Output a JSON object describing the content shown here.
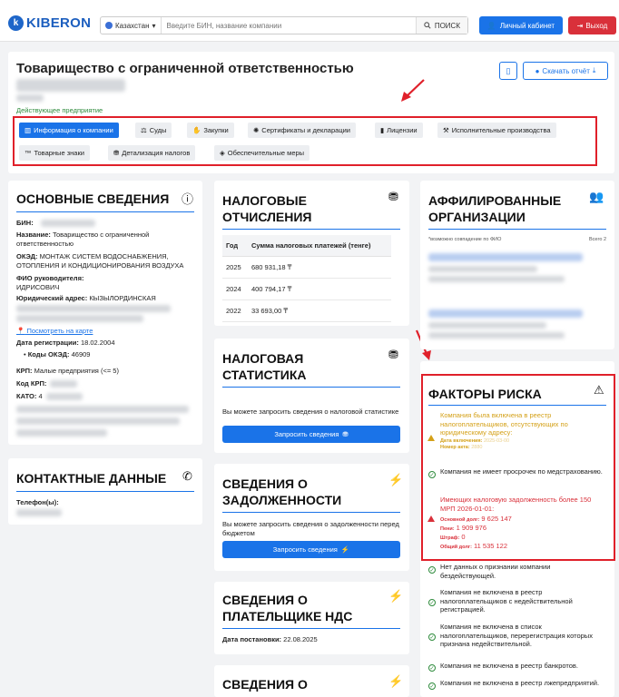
{
  "header": {
    "logo_text": "KIBERON",
    "country": "Казахстан",
    "search_placeholder": "Введите БИН, название компании",
    "search_button": "ПОИСК",
    "cabinet_button": "Личный кабинет",
    "exit_button": "Выход"
  },
  "company": {
    "title": "Товарищество с ограниченной ответственностью",
    "status": "Действующее предприятие",
    "download_button": "Скачать отчёт"
  },
  "tabs": [
    {
      "label": "Информация о компании",
      "active": true
    },
    {
      "label": "Суды"
    },
    {
      "label": "Закупки"
    },
    {
      "label": "Сертификаты и декларации"
    },
    {
      "label": "Лицензии"
    },
    {
      "label": "Исполнительные производства"
    },
    {
      "label": "Товарные знаки"
    },
    {
      "label": "Детализация налогов"
    },
    {
      "label": "Обеспечительные меры"
    }
  ],
  "basic": {
    "title": "ОСНОВНЫЕ СВЕДЕНИЯ",
    "bin_label": "БИН:",
    "name_label": "Название:",
    "name_value": "Товарищество с ограниченной ответственностью",
    "oked_label": "ОКЭД:",
    "oked_value": "МОНТАЖ СИСТЕМ ВОДОСНАБЖЕНИЯ, ОТОПЛЕНИЯ И КОНДИЦИОНИРОВАНИЯ ВОЗДУХА",
    "director_label": "ФИО руководителя:",
    "director_value": "ИДРИСОВИЧ",
    "address_label": "Юридический адрес:",
    "address_value": "КЫЗЫЛОРДИНСКАЯ",
    "map_link": "Посмотреть на карте",
    "reg_label": "Дата регистрации:",
    "reg_value": "18.02.2004",
    "oked_codes_label": "Коды ОКЭД:",
    "oked_codes_value": "46909",
    "krp_label": "КРП:",
    "krp_value": "Малые предприятия (<= 5)",
    "krp_code_label": "Код КРП:",
    "kato_label": "КАТО:",
    "kato_value": "4"
  },
  "contacts": {
    "title": "КОНТАКТНЫЕ ДАННЫЕ",
    "phones_label": "Телефон(ы):"
  },
  "tax": {
    "title_line1": "НАЛОГОВЫЕ",
    "title_line2": "ОТЧИСЛЕНИЯ",
    "col_year": "Год",
    "col_sum": "Сумма налоговых платежей (тенге)",
    "rows": [
      {
        "year": "2025",
        "sum": "680 931,18 ₸"
      },
      {
        "year": "2024",
        "sum": "400 794,17 ₸"
      },
      {
        "year": "2022",
        "sum": "33 693,00 ₸"
      }
    ]
  },
  "tax_stat": {
    "title_line1": "НАЛОГОВАЯ",
    "title_line2": "СТАТИСТИКА",
    "desc": "Вы можете запросить сведения о налоговой статистике",
    "button": "Запросить сведения"
  },
  "debt": {
    "title_line1": "СВЕДЕНИЯ О",
    "title_line2": "ЗАДОЛЖЕННОСТИ",
    "desc": "Вы можете запросить сведения о задолженности перед бюджетом",
    "button": "Запросить сведения"
  },
  "vat": {
    "title_line1": "СВЕДЕНИЯ О",
    "title_line2": "ПЛАТЕЛЬЩИКЕ НДС",
    "date_label": "Дата постановки:",
    "date_value": "22.08.2025"
  },
  "last": {
    "title_line1": "СВЕДЕНИЯ О"
  },
  "affiliates": {
    "title_line1": "АФФИЛИРОВАННЫЕ",
    "title_line2": "ОРГАНИЗАЦИИ",
    "note": "*возможно совпадение по ФИО",
    "total": "Всего 2"
  },
  "risk": {
    "title": "ФАКТОРЫ РИСКА",
    "item1": "Компания была включена в реестр налогоплательщиков, отсутствующих по юридическому адресу:",
    "item1_date_label": "Дата включения:",
    "item1_date_value": "2025-03-00",
    "item1_num_label": "Номер акта:",
    "item1_num_value": "2880",
    "item2": "Компания не имеет просрочек по медстрахованию.",
    "item3": "Имеющих налоговую задолженность более 150 МРП 2026-01-01:",
    "debt_main_label": "Основной долг:",
    "debt_main_value": "9 625 147",
    "penalty_label": "Пени:",
    "penalty_value": "1 909 976",
    "fine_label": "Штраф:",
    "fine_value": "0",
    "total_label": "Общий долг:",
    "total_value": "11 535 122",
    "item4": "Нет данных о признании компании бездействующей.",
    "item5": "Компания не включена в реестр налогоплательщиков с недействительной регистрацией.",
    "item6": "Компания не включена в список налогоплательщиков, перерегистрация которых признана недействительной.",
    "item7": "Компания не включена в реестр банкротов.",
    "item8": "Компания не включена в реестр лжепредприятий."
  },
  "colors": {
    "accent": "#1a73e8",
    "danger": "#e0202a",
    "success": "#2e8b3c",
    "warning": "#d4a017"
  }
}
